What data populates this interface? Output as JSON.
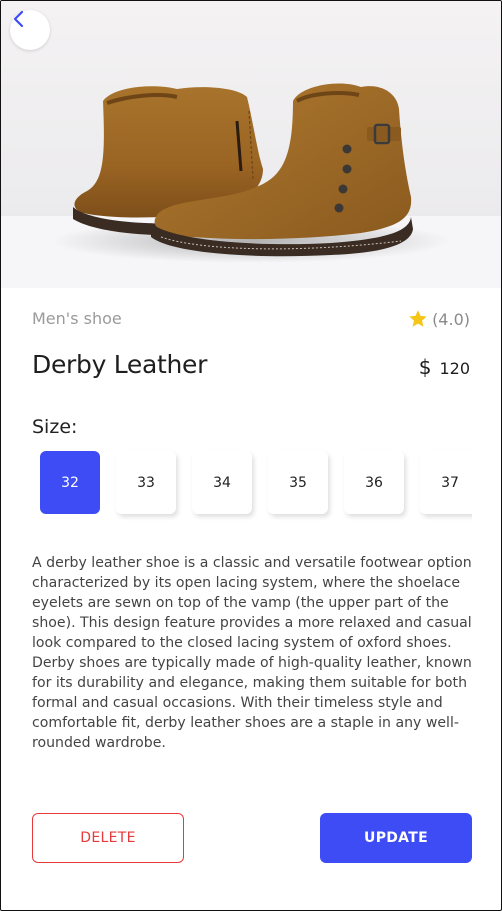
{
  "product": {
    "image_alt": "Brown suede boots",
    "category": "Men's shoe",
    "rating": "(4.0)",
    "rating_icon": "star-icon",
    "name": "Derby Leather",
    "currency": "$",
    "price": "120"
  },
  "nav": {
    "back_icon": "chevron-left-icon"
  },
  "sizes": {
    "label": "Size:",
    "options": [
      "32",
      "33",
      "34",
      "35",
      "36",
      "37"
    ],
    "selected": "32"
  },
  "description": "A derby leather shoe is a classic and versatile footwear option characterized by its open lacing system, where the shoelace eyelets are sewn on top of the vamp (the upper part of the shoe). This design feature provides a more relaxed and casual look compared to the closed lacing system of oxford shoes. Derby shoes are typically made of high-quality leather, known for its durability and elegance, making them suitable for both formal and casual occasions. With their timeless style and comfortable fit, derby leather shoes are a staple in any well-rounded wardrobe.",
  "actions": {
    "delete_label": "DELETE",
    "update_label": "UPDATE"
  },
  "colors": {
    "accent": "#3d4cf5",
    "danger": "#e83a3a",
    "star": "#f5c518"
  }
}
